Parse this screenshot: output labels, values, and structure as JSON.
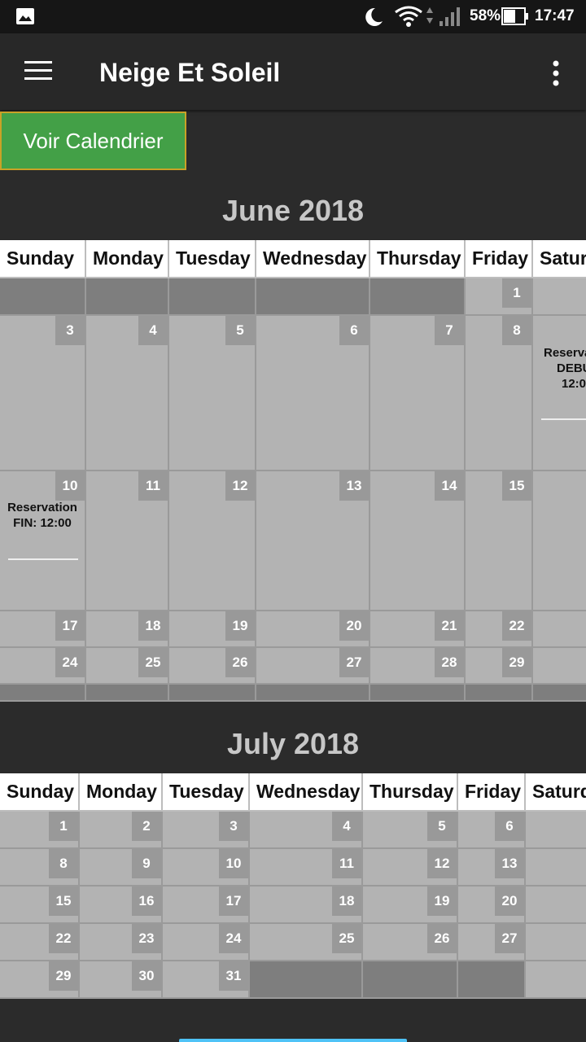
{
  "status": {
    "battery": "58%",
    "time": "17:47"
  },
  "app": {
    "title": "Neige Et Soleil"
  },
  "voir_button": "Voir Calendrier",
  "weekdays_june": [
    "Sunday",
    "Monday",
    "Tuesday",
    "Wednesday",
    "Thursday",
    "Friday",
    "Satur"
  ],
  "weekdays_july": [
    "Sunday",
    "Monday",
    "Tuesday",
    "Wednesday",
    "Thursday",
    "Friday",
    "Saturd"
  ],
  "june": {
    "title": "June 2018",
    "weeks": [
      [
        "",
        "",
        "",
        "",
        "",
        "1",
        ""
      ],
      [
        "3",
        "4",
        "5",
        "6",
        "7",
        "8",
        ""
      ],
      [
        "10",
        "11",
        "12",
        "13",
        "14",
        "15",
        ""
      ],
      [
        "17",
        "18",
        "19",
        "20",
        "21",
        "22",
        ""
      ],
      [
        "24",
        "25",
        "26",
        "27",
        "28",
        "29",
        ""
      ],
      [
        "",
        "",
        "",
        "",
        "",
        "",
        ""
      ]
    ],
    "events": {
      "start": {
        "line1": "Reserva",
        "line2": "DEBU",
        "line3": "12:0"
      },
      "end": {
        "line1": "Reservation",
        "line2": "FIN: 12:00"
      }
    }
  },
  "july": {
    "title": "July 2018",
    "weeks": [
      [
        "1",
        "2",
        "3",
        "4",
        "5",
        "6",
        ""
      ],
      [
        "8",
        "9",
        "10",
        "11",
        "12",
        "13",
        ""
      ],
      [
        "15",
        "16",
        "17",
        "18",
        "19",
        "20",
        ""
      ],
      [
        "22",
        "23",
        "24",
        "25",
        "26",
        "27",
        ""
      ],
      [
        "29",
        "30",
        "31",
        "",
        "",
        "",
        ""
      ]
    ]
  },
  "icons": [
    "image-icon",
    "moon-icon",
    "wifi-icon",
    "signal-icon",
    "battery-icon",
    "hamburger-menu-icon",
    "overflow-menu-icon"
  ]
}
